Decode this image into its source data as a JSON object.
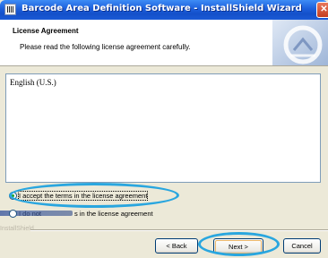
{
  "window": {
    "title": "Barcode Area Definition Software - InstallShield Wizard",
    "close_glyph": "✕"
  },
  "header": {
    "title": "License Agreement",
    "subtitle": "Please read the following license agreement carefully."
  },
  "license": {
    "text": "English (U.S.)"
  },
  "options": {
    "accept_label": "I accept the terms in the license agreement",
    "decline_label_start": "I do not",
    "decline_label_end": "s in the license agreement",
    "selected": "accept"
  },
  "footer": {
    "brand": "InstallShield",
    "back_label": "< Back",
    "next_label": "Next >",
    "cancel_label": "Cancel"
  },
  "annotation": {
    "color": "#29a6df"
  },
  "icons": [
    "app-icon",
    "close-icon",
    "header-graphic-icon",
    "radio-icon"
  ]
}
